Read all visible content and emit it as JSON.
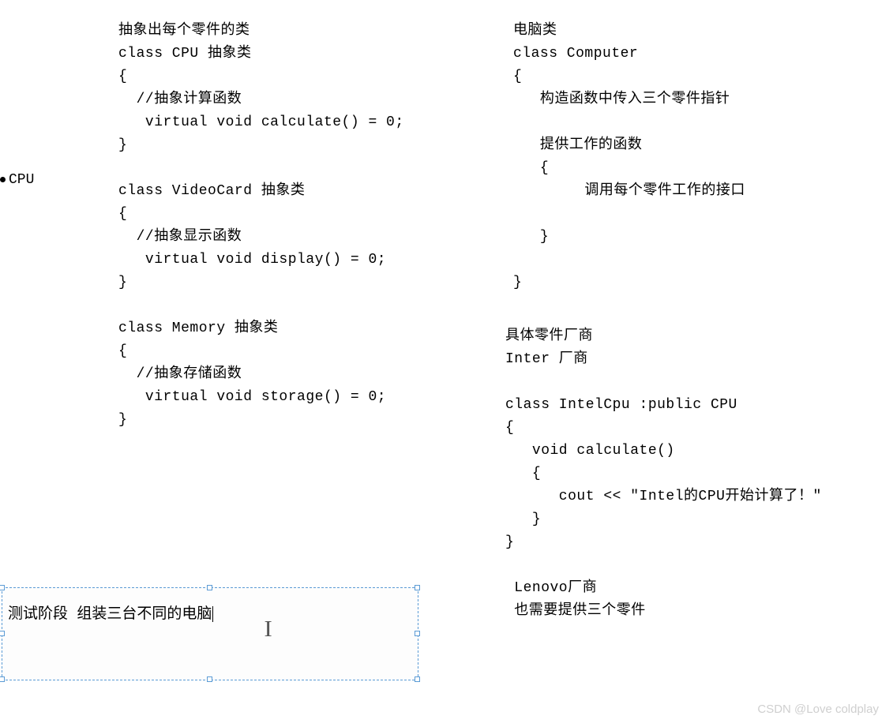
{
  "bullet_label": "CPU",
  "left_block": "抽象出每个零件的类\nclass CPU 抽象类\n{\n  //抽象计算函数\n   virtual void calculate() = 0;\n}\n\nclass VideoCard 抽象类\n{\n  //抽象显示函数\n   virtual void display() = 0;\n}\n\nclass Memory 抽象类\n{\n  //抽象存储函数\n   virtual void storage() = 0;\n}",
  "right_block_1": "电脑类\nclass Computer\n{\n   构造函数中传入三个零件指针\n\n   提供工作的函数\n   {\n        调用每个零件工作的接口\n\n   }\n\n}",
  "right_block_2": "具体零件厂商\nInter 厂商\n\nclass IntelCpu :public CPU\n{\n   void calculate()\n   {\n      cout << \"Intel的CPU开始计算了！\"\n   }\n}\n\n Lenovo厂商\n 也需要提供三个零件",
  "selection_text": "测试阶段 组装三台不同的电脑",
  "watermark": "CSDN @Love coldplay"
}
